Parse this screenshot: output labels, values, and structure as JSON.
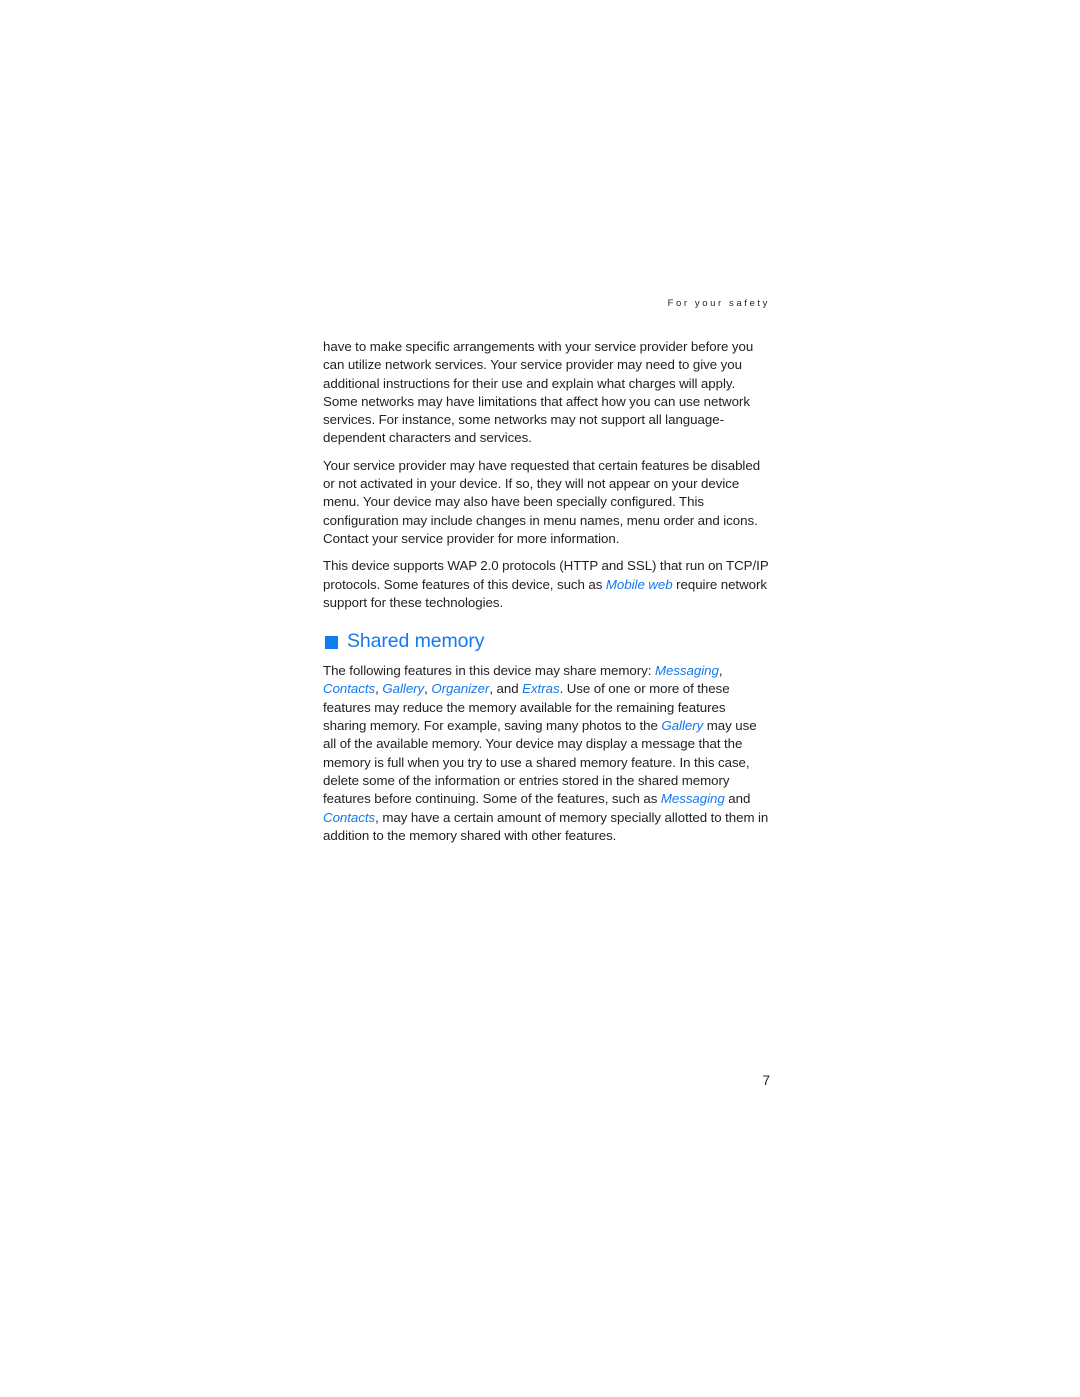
{
  "page": {
    "running_header": "For your safety",
    "folio": "7",
    "accent_color": "#1479f0",
    "text_color": "#231f20",
    "background_color": "#ffffff"
  },
  "paragraphs": [
    {
      "id": "network-services",
      "runs": [
        {
          "text": "have to make specific arrangements with your service provider before you can utilize network services. Your service provider may need to give you additional instructions for their use and explain what charges will apply. Some networks may have limitations that affect how you can use network services. For instance, some networks may not support all language-dependent characters and services.",
          "style": "normal"
        }
      ]
    },
    {
      "id": "provider-configuration",
      "runs": [
        {
          "text": "Your service provider may have requested that certain features be disabled or not activated in your device. If so, they will not appear on your device menu. Your device may also have been specially configured. This configuration may include changes in menu names, menu order and icons. Contact your service provider for more information.",
          "style": "normal"
        }
      ]
    },
    {
      "id": "wap-protocols",
      "runs": [
        {
          "text": "This device supports WAP 2.0 protocols (HTTP and SSL) that run on TCP/IP protocols. Some features of this device, such as ",
          "style": "normal"
        },
        {
          "text": "Mobile web",
          "style": "ref"
        },
        {
          "text": " require network support for these technologies.",
          "style": "normal"
        }
      ]
    }
  ],
  "section": {
    "bullet": "square-bullet",
    "title": "Shared memory",
    "paragraph": {
      "id": "shared-memory-body",
      "runs": [
        {
          "text": "The following features in this device may share memory: ",
          "style": "normal"
        },
        {
          "text": "Messaging",
          "style": "ref"
        },
        {
          "text": ", ",
          "style": "normal"
        },
        {
          "text": "Contacts",
          "style": "ref"
        },
        {
          "text": ", ",
          "style": "normal"
        },
        {
          "text": "Gallery",
          "style": "ref"
        },
        {
          "text": ", ",
          "style": "normal"
        },
        {
          "text": "Organizer",
          "style": "ref"
        },
        {
          "text": ", and ",
          "style": "normal"
        },
        {
          "text": "Extras",
          "style": "ref"
        },
        {
          "text": ". Use of one or more of these features may reduce the memory available for the remaining features sharing memory. For example, saving many photos to the ",
          "style": "normal"
        },
        {
          "text": "Gallery",
          "style": "ref"
        },
        {
          "text": " may use all of the available memory. Your device may display a message that the memory is full when you try to use a shared memory feature. In this case, delete some of the information or entries stored in the shared memory features before continuing. Some of the features, such as ",
          "style": "normal"
        },
        {
          "text": "Messaging",
          "style": "ref"
        },
        {
          "text": " and ",
          "style": "normal"
        },
        {
          "text": "Contacts",
          "style": "ref"
        },
        {
          "text": ", may have a certain amount of memory specially allotted to them in addition to the memory shared with other features.",
          "style": "normal"
        }
      ]
    }
  }
}
